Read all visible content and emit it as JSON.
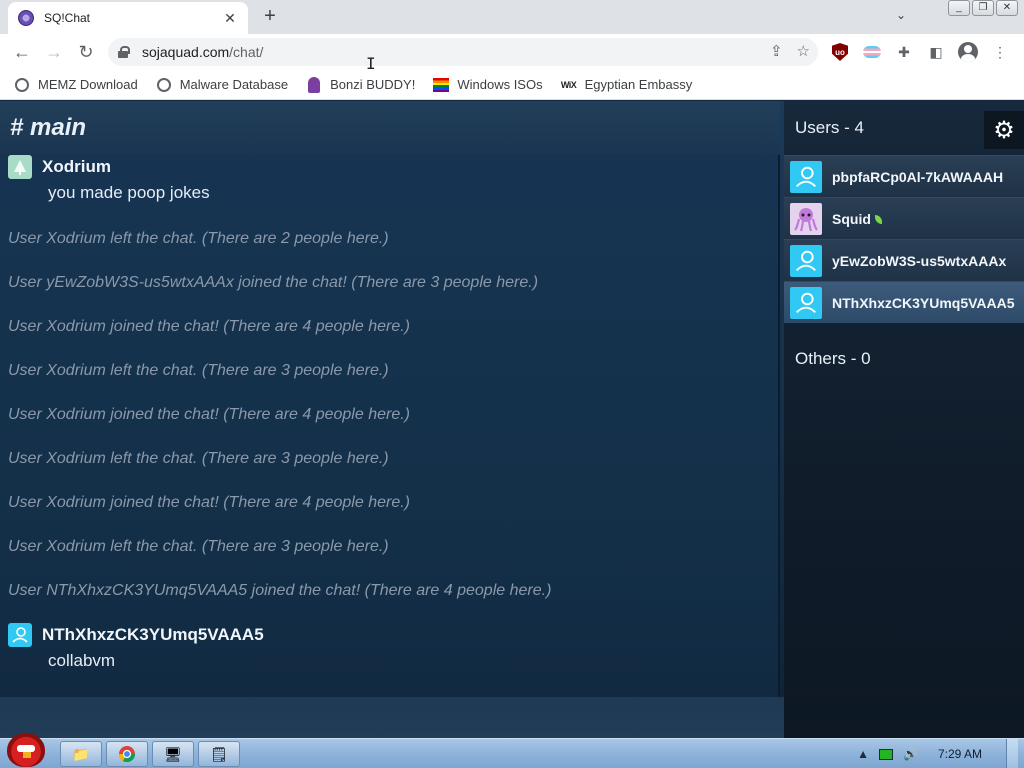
{
  "browser": {
    "tab_title": "SQ!Chat",
    "tab_close": "✕",
    "new_tab": "+",
    "tab_search": "⌄",
    "url_host": "sojaquad.com",
    "url_path": "/chat/",
    "bookmarks": [
      {
        "label": "MEMZ Download",
        "icon": "globe-icon"
      },
      {
        "label": "Malware Database",
        "icon": "globe-icon"
      },
      {
        "label": "Bonzi BUDDY!",
        "icon": "bonzi-icon"
      },
      {
        "label": "Windows ISOs",
        "icon": "rainbow-flag-icon"
      },
      {
        "label": "Egyptian Embassy",
        "icon": "wix-icon"
      }
    ],
    "wix_text": "WiX",
    "ublock_text": "uo"
  },
  "chat": {
    "channel": "# main",
    "messages": [
      {
        "user": "Xodrium",
        "text": "you made poop jokes",
        "avatar": "tree-avatar"
      },
      {
        "system": "User Xodrium left the chat. (There are 2 people here.)"
      },
      {
        "system": "User yEwZobW3S-us5wtxAAAx joined the chat! (There are 3 people here.)"
      },
      {
        "system": "User Xodrium joined the chat! (There are 4 people here.)"
      },
      {
        "system": "User Xodrium left the chat. (There are 3 people here.)"
      },
      {
        "system": "User Xodrium joined the chat! (There are 4 people here.)"
      },
      {
        "system": "User Xodrium left the chat. (There are 3 people here.)"
      },
      {
        "system": "User Xodrium joined the chat! (There are 4 people here.)"
      },
      {
        "system": "User Xodrium left the chat. (There are 3 people here.)"
      },
      {
        "system": "User NThXhxzCK3YUmq5VAAA5 joined the chat! (There are 4 people here.)"
      },
      {
        "user": "NThXhxzCK3YUmq5VAAA5",
        "text": "collabvm",
        "avatar": "default-avatar"
      }
    ]
  },
  "sidebar": {
    "users_title": "Users - 4",
    "users": [
      {
        "name": "pbpfaRCp0Al-7kAWAAAH",
        "avatar": "default-avatar"
      },
      {
        "name": "Squid",
        "avatar": "squid-avatar",
        "badge": "leaf-icon"
      },
      {
        "name": "yEwZobW3S-us5wtxAAAx",
        "avatar": "default-avatar"
      },
      {
        "name": "NThXhxzCK3YUmq5VAAA5",
        "avatar": "default-avatar",
        "selected": true
      }
    ],
    "others_title": "Others - 0"
  },
  "taskbar": {
    "clock": "7:29 AM"
  },
  "colors": {
    "avatar_blue": "#31c9f4",
    "app_bg": "#163452",
    "system_text": "#8b99aa"
  }
}
